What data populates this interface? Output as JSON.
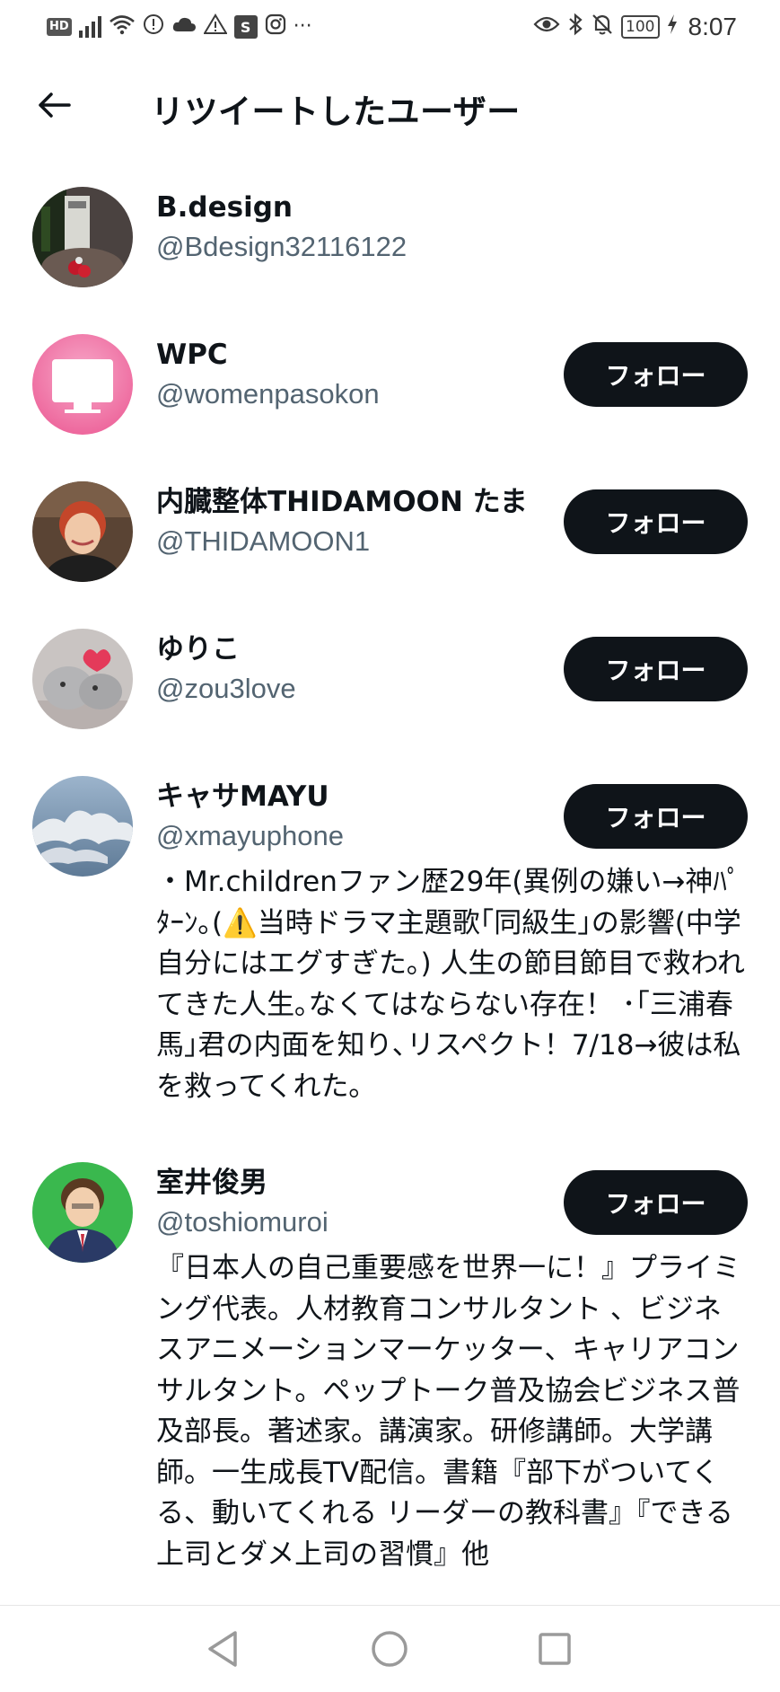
{
  "status_bar": {
    "hd_label": "HD",
    "s_label": "S",
    "more": "···",
    "battery": "100",
    "time": "8:07"
  },
  "header": {
    "title": "リツイートしたユーザー",
    "back_icon": "arrow-left-icon"
  },
  "users": [
    {
      "name": "B.design",
      "handle": "@Bdesign32116122",
      "follow_label": "",
      "bio": ""
    },
    {
      "name": "WPC",
      "handle": "@womenpasokon",
      "follow_label": "フォロー",
      "bio": ""
    },
    {
      "name": "内臓整体THIDAMOON たま",
      "handle": "@THIDAMOON1",
      "follow_label": "フォロー",
      "bio": ""
    },
    {
      "name": "ゆりこ",
      "handle": "@zou3love",
      "follow_label": "フォロー",
      "bio": ""
    },
    {
      "name": "キャサMAYU",
      "handle": "@xmayuphone",
      "follow_label": "フォロー",
      "bio": "・Mr.childrenファン歴29年(異例の嫌い→神ﾊﾟﾀｰﾝ｡(⚠️当時ドラマ主題歌｢同級生｣の影響(中学自分にはエグすぎた｡) 人生の節目節目で救われてきた人生｡なくてはならない存在！ ･｢三浦春馬｣君の内面を知り､リスペクト！7/18→彼は私を救ってくれた｡"
    },
    {
      "name": "室井俊男",
      "handle": "@toshiomuroi",
      "follow_label": "フォロー",
      "bio": "『日本人の自己重要感を世界一に！』プライミング代表。人材教育コンサルタント 、ビジネスアニメーションマーケッター、キャリアコンサルタント。ペップトーク普及協会ビジネス普及部長。著述家。講演家。研修講師。大学講師。一生成長TV配信。書籍『部下がついてくる、動いてくれる リーダーの教科書』『できる上司とダメ上司の習慣』他"
    }
  ],
  "colors": {
    "button_bg": "#0f1419",
    "handle_gray": "#536471"
  },
  "nav": {
    "back": "triangle-back-icon",
    "home": "circle-home-icon",
    "recents": "square-recents-icon"
  }
}
